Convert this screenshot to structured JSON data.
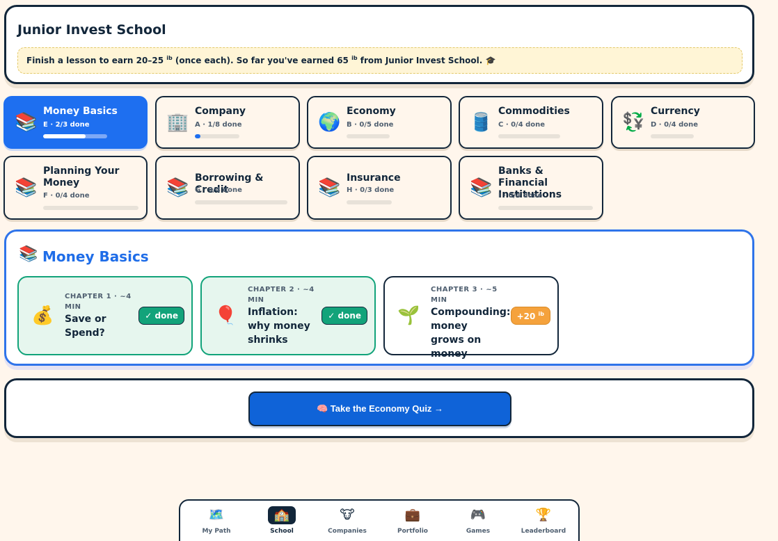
{
  "header": {
    "title": "Junior Invest School",
    "note_pre": "Finish a lesson to earn 20–25",
    "note_mid": "(once each). So far you've earned 65",
    "note_post": "from Junior Invest School.",
    "coin_unit": "ib",
    "grad_icon": "🎓"
  },
  "topics": [
    {
      "emoji": "📚",
      "name": "Money Basics",
      "sub": "E · 2/3 done",
      "progress": 0.667,
      "active": true
    },
    {
      "emoji": "🏢",
      "name": "Company",
      "sub": "A · 1/8 done",
      "progress": 0.125,
      "active": false
    },
    {
      "emoji": "🌍",
      "name": "Economy",
      "sub": "B · 0/5 done",
      "progress": 0,
      "active": false
    },
    {
      "emoji": "🛢️",
      "name": "Commodities",
      "sub": "C · 0/4 done",
      "progress": 0,
      "active": false
    },
    {
      "emoji": "💱",
      "name": "Currency",
      "sub": "D · 0/4 done",
      "progress": 0,
      "active": false
    },
    {
      "emoji": "📚",
      "name": "Planning Your Money",
      "sub": "F · 0/4 done",
      "progress": 0,
      "active": false
    },
    {
      "emoji": "📚",
      "name": "Borrowing & Credit",
      "sub": "G · 0/4 done",
      "progress": 0,
      "active": false
    },
    {
      "emoji": "📚",
      "name": "Insurance",
      "sub": "H · 0/3 done",
      "progress": 0,
      "active": false
    },
    {
      "emoji": "📚",
      "name": "Banks & Financial Institutions",
      "sub": "I · 0/4 done",
      "progress": 0,
      "active": false
    }
  ],
  "selected": {
    "icon": "📚",
    "title": "Money Basics",
    "chapters": [
      {
        "emoji": "💰",
        "meta": "CHAPTER 1 · ~4 MIN",
        "title": "Save or Spend?",
        "badge": "✓ done",
        "status": "done"
      },
      {
        "emoji": "🎈",
        "meta": "CHAPTER 2 · ~4 MIN",
        "title": "Inflation: why money shrinks",
        "badge": "✓ done",
        "status": "done"
      },
      {
        "emoji": "🌱",
        "meta": "CHAPTER 3 · ~5 MIN",
        "title": "Compounding: money grows on money",
        "badge": "+20",
        "badge_unit": "ib",
        "status": "pending"
      }
    ]
  },
  "quiz": {
    "label": "🧠 Take the Economy Quiz →"
  },
  "nav": [
    {
      "icon": "🗺️",
      "label": "My Path",
      "active": false
    },
    {
      "icon": "🏫",
      "label": "School",
      "active": true
    },
    {
      "icon": "🐮",
      "label": "Companies",
      "active": false
    },
    {
      "icon": "💼",
      "label": "Portfolio",
      "active": false
    },
    {
      "icon": "🎮",
      "label": "Games",
      "active": false
    },
    {
      "icon": "🏆",
      "label": "Leaderboard",
      "active": false
    }
  ],
  "colors": {
    "accent": "#1e6ff0",
    "done": "#12a37a",
    "reward": "#f5a23c",
    "ink": "#12263a"
  }
}
